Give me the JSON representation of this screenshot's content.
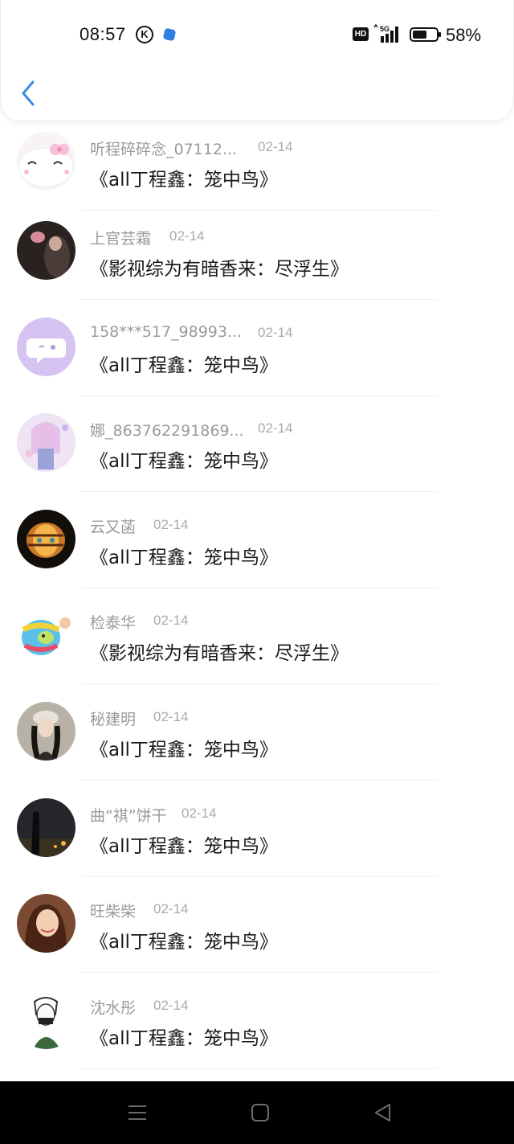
{
  "status_bar": {
    "time": "08:57",
    "k_badge": "K",
    "hd_label": "HD",
    "network": "5G",
    "battery": "58%"
  },
  "header": {
    "back_icon": "chevron-left-icon"
  },
  "items": [
    {
      "name": "听程碎碎念_07112...",
      "date": "02-14",
      "title": "《all丁程鑫：笼中鸟》",
      "avatar_bg": "#f3eef4"
    },
    {
      "name": "上官芸霜",
      "date": "02-14",
      "title": "《影视综为有暗香来：尽浮生》",
      "avatar_bg": "#2a2220"
    },
    {
      "name": "158***517_98993...",
      "date": "02-14",
      "title": "《all丁程鑫：笼中鸟》",
      "avatar_bg": "#d6c3f2"
    },
    {
      "name": "娜_863762291869...",
      "date": "02-14",
      "title": "《all丁程鑫：笼中鸟》",
      "avatar_bg": "#e9dff0"
    },
    {
      "name": "云又菡",
      "date": "02-14",
      "title": "《all丁程鑫：笼中鸟》",
      "avatar_bg": "#1a1510"
    },
    {
      "name": "检泰华",
      "date": "02-14",
      "title": "《影视综为有暗香来：尽浮生》",
      "avatar_bg": "#ffffff"
    },
    {
      "name": "秘建明",
      "date": "02-14",
      "title": "《all丁程鑫：笼中鸟》",
      "avatar_bg": "#8a8478"
    },
    {
      "name": "曲“祺”饼干",
      "date": "02-14",
      "title": "《all丁程鑫：笼中鸟》",
      "avatar_bg": "#2b2a2e"
    },
    {
      "name": "旺柴柴",
      "date": "02-14",
      "title": "《all丁程鑫：笼中鸟》",
      "avatar_bg": "#7a4a32"
    },
    {
      "name": "沈水彤",
      "date": "02-14",
      "title": "《all丁程鑫：笼中鸟》",
      "avatar_bg": "#ffffff"
    }
  ],
  "colors": {
    "accent": "#3a8ee6",
    "navbar": "#000000"
  }
}
